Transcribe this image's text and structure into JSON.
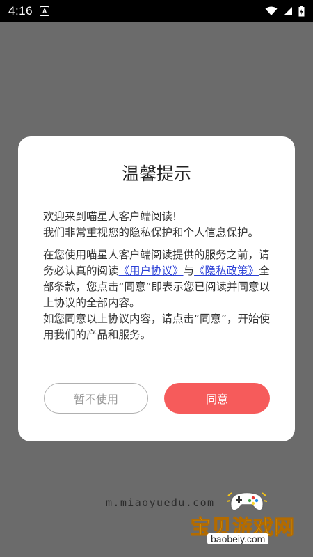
{
  "status_bar": {
    "time": "4:16",
    "notification_icon": "A",
    "icons": [
      "wifi-icon",
      "signal-icon",
      "battery-icon"
    ]
  },
  "dialog": {
    "title": "温馨提示",
    "welcome": "欢迎来到喵星人客户端阅读!",
    "privacy_line": "我们非常重视您的隐私保护和个人信息保护。",
    "intro": "在您使用喵星人客户端阅读提供的服务之前，请务必认真的阅读",
    "user_agreement_link": "《用户协议》",
    "conjunction": "与",
    "privacy_policy_link": "《隐私政策》",
    "consent_text": "全部条款，您点击“同意”即表示您已阅读并同意以上协议的全部内容。",
    "instruction": "如您同意以上协议内容，请点击“同意”，开始使用我们的产品和服务。",
    "decline_label": "暂不使用",
    "agree_label": "同意"
  },
  "background": {
    "site_url": "m.miaoyuedu.com"
  },
  "watermark": {
    "title": "宝贝游戏网",
    "url": "baobeiy.com"
  },
  "colors": {
    "overlay": "#6b6b6b",
    "agree_button": "#f65b5b",
    "link": "#2a3fd6"
  }
}
